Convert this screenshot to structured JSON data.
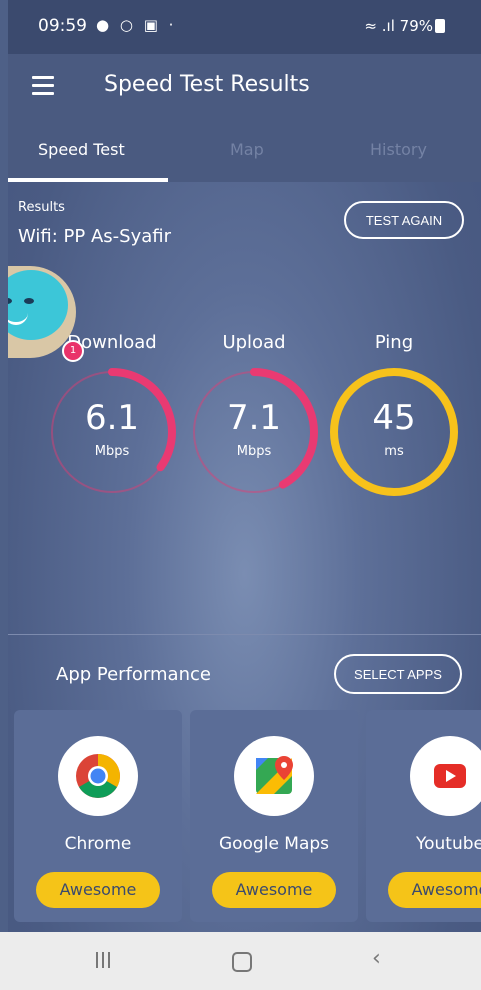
{
  "status_bar": {
    "time": "09:59",
    "battery": "79%"
  },
  "app_bar": {
    "title": "Speed Test Results"
  },
  "tabs": [
    "Speed Test",
    "Map",
    "History"
  ],
  "results": {
    "label": "Results",
    "network": "Wifi: PP As-Syafir",
    "test_again": "TEST AGAIN"
  },
  "avatar_badge": "1",
  "metrics": {
    "download": {
      "label": "Download",
      "value": "6.1",
      "unit": "Mbps",
      "progress": 0.35,
      "color": "#e93a72"
    },
    "upload": {
      "label": "Upload",
      "value": "7.1",
      "unit": "Mbps",
      "progress": 0.42,
      "color": "#e93a72"
    },
    "ping": {
      "label": "Ping",
      "value": "45",
      "unit": "ms",
      "progress": 1.0,
      "color": "#f7c21b"
    }
  },
  "app_performance": {
    "title": "App Performance",
    "select_apps": "SELECT APPS",
    "apps": [
      {
        "name": "Chrome",
        "rating": "Awesome",
        "icon": "chrome-icon"
      },
      {
        "name": "Google Maps",
        "rating": "Awesome",
        "icon": "maps-icon"
      },
      {
        "name": "Youtube",
        "rating": "Awesome",
        "icon": "youtube-icon"
      }
    ]
  },
  "colors": {
    "accent_pink": "#e93a72",
    "accent_yellow": "#f7c21b",
    "background": "#4e6087"
  }
}
